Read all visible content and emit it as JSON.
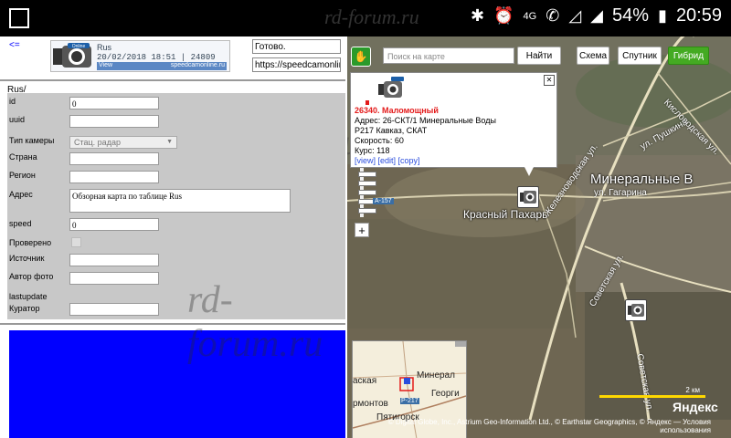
{
  "statusbar": {
    "watermark": "rd-forum.ru",
    "network": "4G",
    "battery_text": "54%",
    "time": "20:59"
  },
  "left": {
    "back_link": "<=",
    "logo": {
      "line1": "Rus",
      "line2": "20/02/2018 18:51 | 24809",
      "line3_left": "View",
      "line3_right": "speedcamonline.ru",
      "badge": "Online"
    },
    "status_box": "Готово.",
    "url_box": "https://speedcamonline",
    "path": "Rus/",
    "form": {
      "fields": [
        {
          "label": "id",
          "value": "0"
        },
        {
          "label": "uuid",
          "value": ""
        },
        {
          "label": "Тип камеры",
          "value": "Стац. радар"
        },
        {
          "label": "Страна",
          "value": ""
        },
        {
          "label": "Регион",
          "value": ""
        },
        {
          "label": "Адрес",
          "value": "Обзорная карта по таблице Rus"
        },
        {
          "label": "speed",
          "value": "0"
        },
        {
          "label": "Проверено",
          "value": ""
        },
        {
          "label": "Источник",
          "value": ""
        },
        {
          "label": "Автор фото",
          "value": ""
        },
        {
          "label": "lastupdate",
          "value": ""
        },
        {
          "label": "Куратор",
          "value": ""
        }
      ]
    },
    "watermark": "rd-forum.ru",
    "colors": {
      "panel": "#c8c8c8",
      "blue_box": "#0000ff"
    }
  },
  "map": {
    "search_placeholder": "Поиск на карте",
    "find_button": "Найти",
    "view_buttons": [
      "Схема",
      "Спутник",
      "Гибрид"
    ],
    "active_view": "Гибрид",
    "zoom_in": "+",
    "zoom_out": "−",
    "popup": {
      "title": "26340. Маломощный",
      "address": "Адрес: 26-СКТ/1 Минеральные Воды",
      "road": "Р217 Кавказ, СКАТ",
      "speed": "Скорость: 60",
      "course": "Курс: 118",
      "links": "[view] [edit] [copy]"
    },
    "labels": {
      "city": "Минеральные В",
      "village": "Красный Пахарь",
      "street1": "ул. Пушкина",
      "street2": "ул. Гагарина",
      "street3": "Советская ул.",
      "street4": "Железноводская ул.",
      "street5": "Советская ул.",
      "street6": "Кисловодская ул.",
      "road1": "А-157",
      "watermark": "rd-forum.ru"
    },
    "minimap": {
      "city1": "Минерал",
      "city2": "Георги",
      "city3": "Пятигорск",
      "city4": "аская",
      "city5": "рмонтов",
      "road": "Р-217"
    },
    "scale_label": "2 км",
    "yandex": "Яндекс",
    "copyright": "© Digital Globe, Inc., Astrium Geo-Information Ltd., © Earthstar Geographics, © Яндекс — Условия использования",
    "colors": {
      "active": "#44aa22",
      "link": "#2a4ddd",
      "title": "#e31a1a",
      "scale": "#ffd800"
    }
  }
}
